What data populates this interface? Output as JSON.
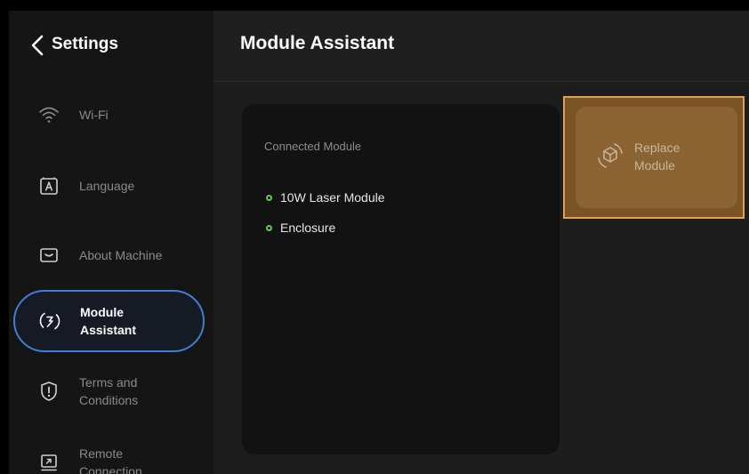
{
  "sidebar": {
    "title": "Settings",
    "items": [
      {
        "label_lines": [
          "Wi-Fi"
        ],
        "icon": "wifi-icon"
      },
      {
        "label_lines": [
          "Language"
        ],
        "icon": "language-icon"
      },
      {
        "label_lines": [
          "About Machine"
        ],
        "icon": "machine-icon"
      },
      {
        "label_lines": [
          "Module",
          "Assistant"
        ],
        "icon": "module-assistant-icon",
        "active": true
      },
      {
        "label_lines": [
          "Terms and",
          "Conditions"
        ],
        "icon": "info-alert-icon"
      },
      {
        "label_lines": [
          "Remote",
          "Connection"
        ],
        "icon": "remote-connection-icon"
      }
    ]
  },
  "main": {
    "title": "Module Assistant",
    "connected_card": {
      "title": "Connected Module",
      "modules": [
        "10W Laser Module",
        "Enclosure"
      ]
    },
    "replace_button": {
      "label_lines": [
        "Replace",
        "Module"
      ],
      "icon": "replace-module-icon"
    }
  },
  "colors": {
    "active_border": "#3f7fd4",
    "status_green": "#5fcb55",
    "highlight_border": "#e0a24c",
    "replace_fill": "#8c6433"
  }
}
